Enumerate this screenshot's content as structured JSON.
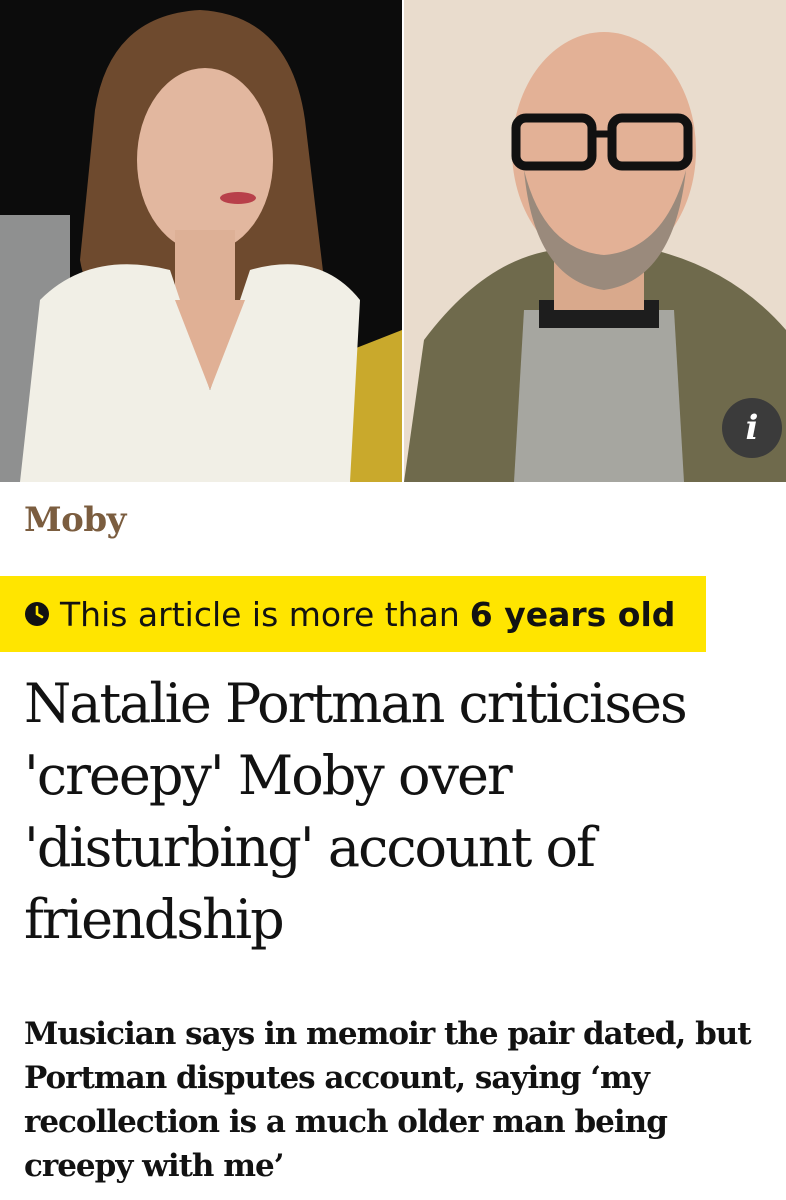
{
  "hero": {
    "info_icon": "info-icon",
    "info_glyph": "i"
  },
  "article": {
    "section": "Moby",
    "age_notice": {
      "icon": "clock-icon",
      "prefix": "This article is more than",
      "age": "6 years old"
    },
    "headline": "Natalie Portman criticises 'creepy' Moby over 'disturbing' account of friendship",
    "standfirst": "Musician says in memoir the pair dated, but Portman disputes account, saying ‘my recollection is a much older man being creepy with me’"
  },
  "colors": {
    "section": "#7b5d3f",
    "banner": "#ffe500",
    "text": "#121212",
    "info_button": "#3b3b3b"
  }
}
